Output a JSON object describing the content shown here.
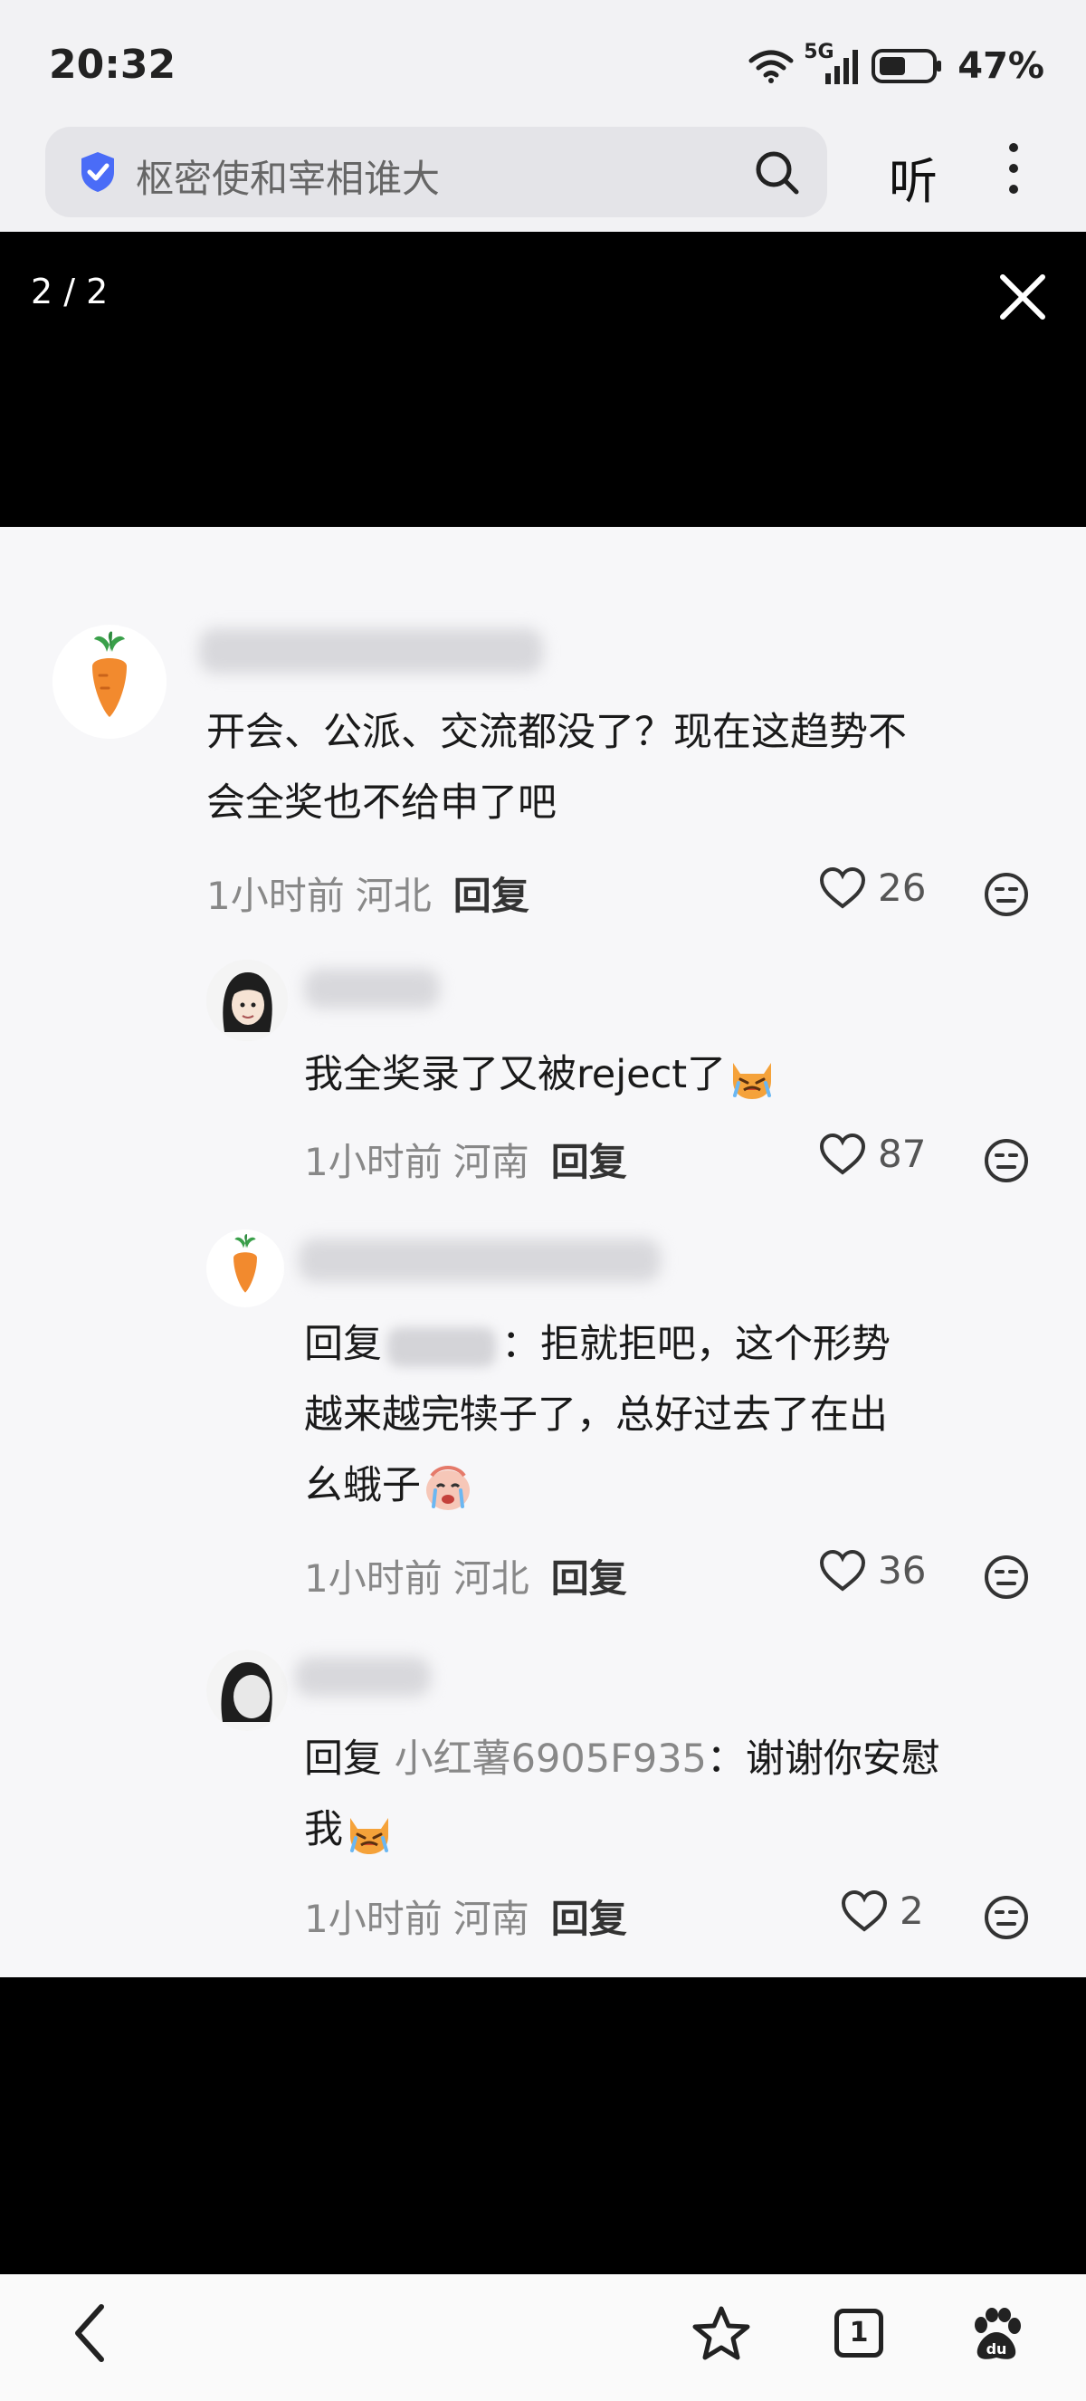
{
  "status_bar": {
    "time": "20:32",
    "network": "5G",
    "battery": "47%"
  },
  "search": {
    "query": "枢密使和宰相谁大"
  },
  "header": {
    "listen_label": "听"
  },
  "viewer": {
    "counter": "2 / 2"
  },
  "comments": [
    {
      "text_line1": "开会、公派、交流都没了？现在这趋势不",
      "text_line2": "会全奖也不给申了吧",
      "time": "1小时前",
      "location": "河北",
      "reply_label": "回复",
      "likes": "26"
    },
    {
      "text": "我全奖录了又被reject了",
      "time": "1小时前",
      "location": "河南",
      "reply_label": "回复",
      "likes": "87"
    },
    {
      "reply_prefix": "回复",
      "text_line1": "：拒就拒吧，这个形势",
      "text_line2": "越来越完犊子了，总好过去了在出",
      "text_line3": "幺蛾子",
      "time": "1小时前",
      "location": "河北",
      "reply_label": "回复",
      "likes": "36"
    },
    {
      "reply_prefix": "回复",
      "replied_to": "小红薯6905F935",
      "text_line1": "：谢谢你安慰",
      "text_line2": "我",
      "time": "1小时前",
      "location": "河南",
      "reply_label": "回复",
      "likes": "2"
    }
  ],
  "nav": {
    "tab_count": "1"
  },
  "icons": {
    "shield": "shield-check-icon",
    "search": "search-icon",
    "more": "more-vertical-icon",
    "close": "close-icon",
    "like": "heart-outline-icon",
    "dislike": "neutral-face-icon",
    "back": "back-chevron-icon",
    "favorite": "star-outline-icon",
    "tabs": "tabs-icon",
    "baidu": "baidu-paw-icon"
  },
  "colors": {
    "shield_blue": "#4a6cf7",
    "viewer_bg": "#000000"
  }
}
